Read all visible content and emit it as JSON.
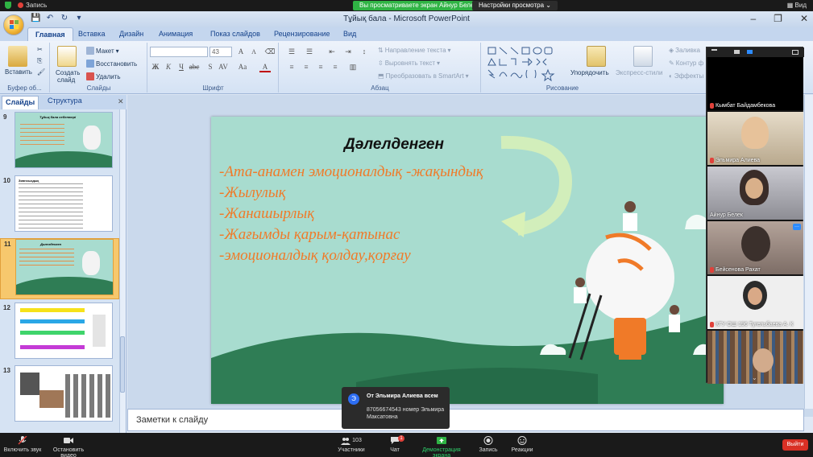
{
  "zoom_top": {
    "recording": "Запись",
    "share_banner": "Вы просматриваете экран Айнур Белек",
    "view_options": "Настройки просмотра ⌄",
    "view": "Вид"
  },
  "window": {
    "title": "Тұйық бала - Microsoft PowerPoint",
    "controls": [
      "–",
      "❐",
      "✕"
    ]
  },
  "ribbon_tabs": [
    "Главная",
    "Вставка",
    "Дизайн",
    "Анимация",
    "Показ слайдов",
    "Рецензирование",
    "Вид"
  ],
  "ribbon": {
    "clipboard": {
      "paste": "Вставить",
      "label": "Буфер об..."
    },
    "slides": {
      "new_slide_1": "Создать",
      "new_slide_2": "слайд",
      "layout": "Макет",
      "reset": "Восстановить",
      "delete": "Удалить",
      "label": "Слайды"
    },
    "font": {
      "size": "43",
      "label": "Шрифт"
    },
    "paragraph": {
      "text_direction": "Направление текста",
      "align_text": "Выровнять текст",
      "smartart": "Преобразовать в SmartArt",
      "label": "Абзац"
    },
    "drawing": {
      "arrange": "Упорядочить",
      "quick_styles": "Экспресс-стили",
      "fill": "Заливка",
      "outline": "Контур ф",
      "effects": "Эффекты",
      "label": "Рисование"
    }
  },
  "slides_pane": {
    "tabs": [
      "Слайды",
      "Структура"
    ],
    "close": "✕",
    "slides": [
      {
        "num": "9",
        "heading": "Тұйық бала себептері"
      },
      {
        "num": "10",
        "heading": "Зиянсыздық"
      },
      {
        "num": "11",
        "heading": "Дәлелденген"
      },
      {
        "num": "12",
        "heading": ""
      },
      {
        "num": "13",
        "heading": ""
      }
    ]
  },
  "slide": {
    "title": "Дәлелденген",
    "lines": [
      "-Ата-анамен эмоционалдық -жақындық",
      "-Жылулық",
      "-Жанашырлық",
      "-Жағымды қарым-қатынас",
      "-эмоционалдық қолдау,қорғау"
    ]
  },
  "notes_placeholder": "Заметки к слайду",
  "gallery": {
    "participants": [
      "Кымбат Байдамбекова",
      "Эльмира Алиева",
      "Айнур Белек",
      "Бейсенова Рахат",
      "КГУ ОШ 196 Тугельбаева А. К",
      ""
    ]
  },
  "chat_toast": {
    "avatar": "Э",
    "from": "От Эльмира Алиева всем",
    "message": "87056674543 номер Эльмира Максатовна"
  },
  "zoom_bottom": {
    "unmute": "Включить звук",
    "stop_video": "Остановить видео",
    "participants_count": "103",
    "participants": "Участники",
    "chat": "Чат",
    "chat_badge": "1",
    "share_screen": "Демонстрация экрана",
    "record": "Запись",
    "reactions": "Реакции",
    "leave": "Выйти"
  },
  "colors": {
    "slide_bg": "#a8dccf",
    "slide_text_orange": "#f07a28",
    "share_green": "#2fb344",
    "leave_red": "#d93025"
  }
}
